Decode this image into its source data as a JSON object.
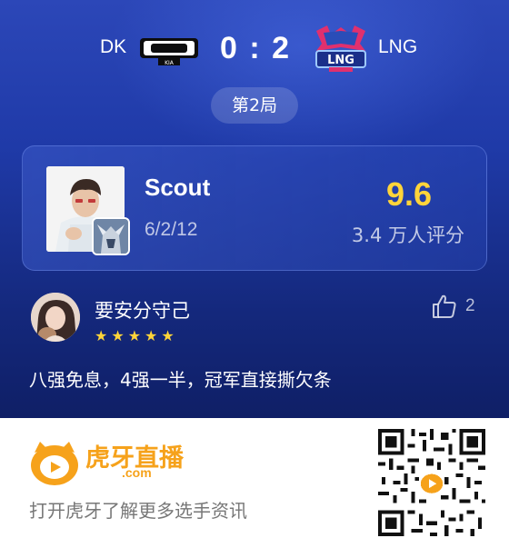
{
  "match": {
    "team_left": "DK",
    "team_right": "LNG",
    "score_left": "0",
    "score_sep": ":",
    "score_right": "2",
    "game_label": "第2局"
  },
  "player": {
    "name": "Scout",
    "kda": "6/2/12",
    "rating": "9.6",
    "rating_count": "3.4 万人评分"
  },
  "comment": {
    "username": "要安分守己",
    "stars": 5,
    "stars_text": "★★★★★",
    "likes": "2",
    "text": "八强免息，4强一半，冠军直接撕欠条"
  },
  "promo": {
    "brand_name": "虎牙直播",
    "brand_domain": ".com",
    "tagline": "打开虎牙了解更多选手资讯"
  },
  "colors": {
    "bg_top": "#2c47b8",
    "bg_bottom": "#0f1f66",
    "rating": "#ffd43a",
    "stars": "#ffd43a",
    "brand": "#f6a21b"
  },
  "icons": [
    "dk-team-logo-icon",
    "lng-team-logo-icon",
    "thumbs-up-icon",
    "huya-logo-icon",
    "qr-code-icon"
  ]
}
